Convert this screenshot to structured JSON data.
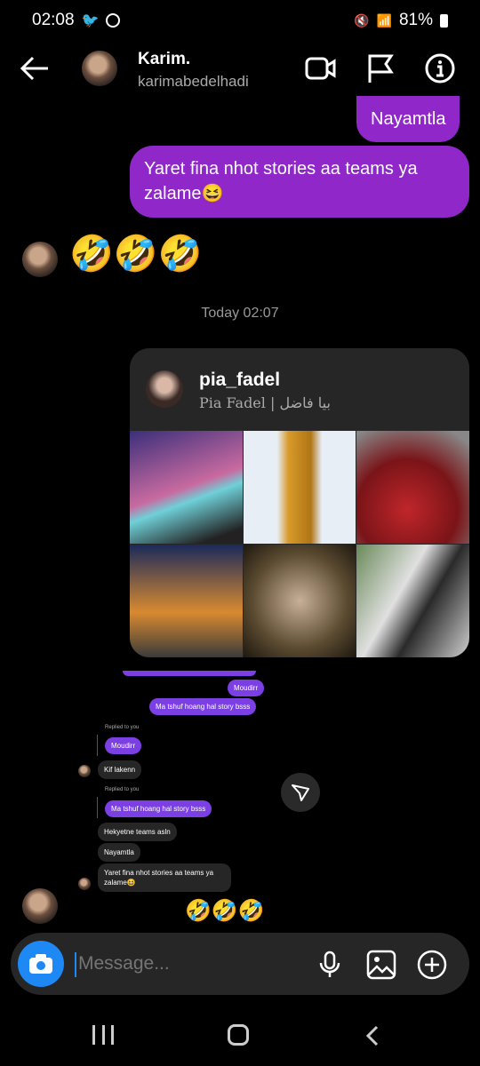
{
  "status_bar": {
    "time": "02:08",
    "battery": "81%"
  },
  "header": {
    "name": "Karim.",
    "username": "karimabedelhadi"
  },
  "messages": {
    "sent_1": "Nayamtla",
    "sent_2": "Yaret fina nhot stories aa teams ya zalame😆",
    "received_emoji": "🤣🤣🤣",
    "timestamp": "Today 02:07"
  },
  "shared_profile": {
    "username": "pia_fadel",
    "full_name": "Pia Fadel | بيا فاضل"
  },
  "embedded_chat": {
    "out_1": "Moudirr",
    "out_2": "Ma tshuf hoang hal story bsss",
    "replied_label_1": "Replied to you",
    "reply_quote_1": "Moudirr",
    "in_1": "Kif lakenn",
    "replied_label_2": "Replied to you",
    "reply_quote_2": "Ma tshuf hoang hal story bsss",
    "in_2": "Hekyetne teams asln",
    "in_3": "Nayamtla",
    "in_4": "Yaret fina nhot stories aa teams ya zalame😆",
    "emoji": "🤣🤣🤣"
  },
  "composer": {
    "placeholder": "Message..."
  },
  "colors": {
    "sent_bubble": "#8f27c9",
    "camera_button": "#1e88f5",
    "card_bg": "#262626"
  }
}
